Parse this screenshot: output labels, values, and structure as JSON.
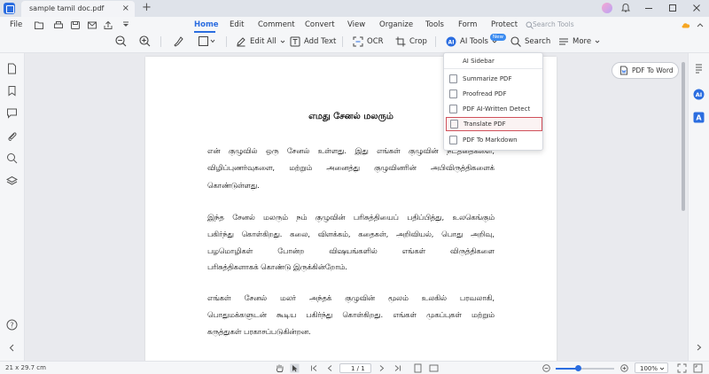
{
  "titlebar": {
    "tab_title": "sample tamil doc.pdf",
    "close_glyph": "×",
    "new_tab_glyph": "+"
  },
  "menu": {
    "file": "File",
    "tabs": [
      {
        "label": "Home",
        "active": true
      },
      {
        "label": "Edit"
      },
      {
        "label": "Comment"
      },
      {
        "label": "Convert"
      },
      {
        "label": "View"
      },
      {
        "label": "Organize"
      },
      {
        "label": "Tools"
      },
      {
        "label": "Form"
      },
      {
        "label": "Protect"
      }
    ],
    "search_tools": "Search Tools"
  },
  "toolbar": {
    "edit_all": "Edit All",
    "add_text": "Add Text",
    "ocr": "OCR",
    "crop": "Crop",
    "ai_tools": "AI Tools",
    "ai_badge": "New",
    "search": "Search",
    "more": "More"
  },
  "ai_menu": {
    "header": "AI Sidebar",
    "items": [
      {
        "label": "Summarize PDF",
        "icon": "summarize-icon"
      },
      {
        "label": "Proofread PDF",
        "icon": "proofread-icon"
      },
      {
        "label": "PDF AI-Written Detect",
        "icon": "ai-detect-icon"
      },
      {
        "label": "Translate PDF",
        "icon": "translate-icon",
        "selected": true
      },
      {
        "label": "PDF To Markdown",
        "icon": "markdown-icon"
      }
    ]
  },
  "document": {
    "title": "எமது சேனல் மலரும்",
    "paragraphs": [
      [
        "என் குழுவில் ஒரு சேனல் உள்ளது. இது எங்கள் குழுவின் நடத்தைகளை,",
        "விழிப்புணர்வுகளை, மற்றும் அனைத்து குழுவினரின் அபிவிருத்திகளைக்",
        "கொண்டுள்ளது."
      ],
      [
        "இந்த சேனல் மலரும் நம் குழுவின் பரிசுத்தியைப் பதிப்பித்து, உலகெங்கும்",
        "பகிர்ந்து கொள்கிறது. கலை, விளக்கம், கதைகள், அறிவியல், பொது அறிவு,",
        "பழமொழிகள் போன்ற விஷயங்களில் எங்கள் விருத்திகளை",
        "பரிசுத்திகளாகக் கொண்டு இருக்கின்றோம்."
      ],
      [
        "எங்கள் சேனல் மலர் அந்தக் குழுவின் மூலம் உலகில் பரவலாகி,",
        "பொதுமக்களுடன் கூடிய பகிர்ந்து கொள்கிறது. எங்கள் முகப்புகள் மற்றும்",
        "கருத்துகள் பரகாசப்படுகின்றன."
      ]
    ],
    "pdf_to_word": "PDF To Word"
  },
  "statusbar": {
    "page_size": "21 x 29.7 cm",
    "page_indicator": "1 / 1",
    "zoom": "100%",
    "zoom_fraction": 0.38
  },
  "colors": {
    "accent": "#2b6de0",
    "selected_border": "#d0505a"
  }
}
